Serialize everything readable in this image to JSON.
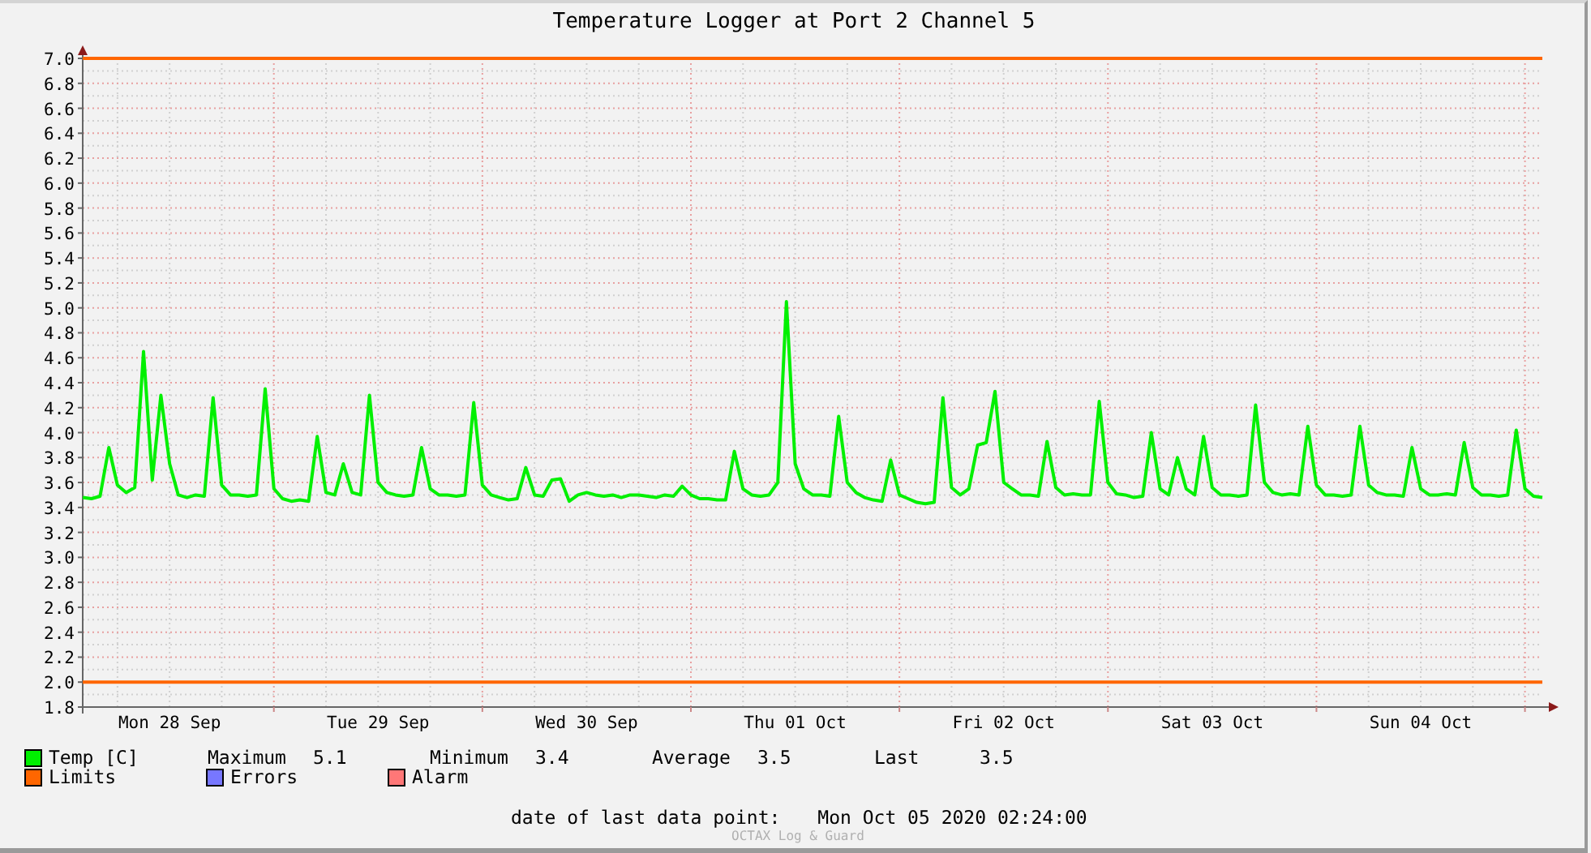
{
  "graph": {
    "chart_data": {
      "type": "line",
      "title": "Temperature Logger at Port 2 Channel 5",
      "series": [
        {
          "name": "Temp [C]",
          "color": "#00f000",
          "values": [
            3.48,
            3.47,
            3.49,
            3.88,
            3.58,
            3.52,
            3.56,
            4.65,
            3.62,
            4.3,
            3.75,
            3.5,
            3.48,
            3.5,
            3.49,
            4.28,
            3.58,
            3.5,
            3.5,
            3.49,
            3.5,
            4.35,
            3.55,
            3.47,
            3.45,
            3.46,
            3.45,
            3.97,
            3.52,
            3.5,
            3.75,
            3.52,
            3.5,
            4.3,
            3.6,
            3.52,
            3.5,
            3.49,
            3.5,
            3.88,
            3.55,
            3.5,
            3.5,
            3.49,
            3.5,
            4.24,
            3.58,
            3.5,
            3.48,
            3.46,
            3.47,
            3.72,
            3.5,
            3.49,
            3.62,
            3.63,
            3.45,
            3.5,
            3.52,
            3.5,
            3.49,
            3.5,
            3.48,
            3.5,
            3.5,
            3.49,
            3.48,
            3.5,
            3.49,
            3.57,
            3.5,
            3.47,
            3.47,
            3.46,
            3.46,
            3.85,
            3.55,
            3.5,
            3.49,
            3.5,
            3.6,
            5.05,
            3.75,
            3.55,
            3.5,
            3.5,
            3.49,
            4.13,
            3.6,
            3.52,
            3.48,
            3.46,
            3.45,
            3.78,
            3.5,
            3.47,
            3.44,
            3.43,
            3.44,
            4.28,
            3.56,
            3.5,
            3.55,
            3.9,
            3.92,
            4.33,
            3.6,
            3.55,
            3.5,
            3.5,
            3.49,
            3.93,
            3.56,
            3.5,
            3.51,
            3.5,
            3.5,
            4.25,
            3.6,
            3.51,
            3.5,
            3.48,
            3.49,
            4.0,
            3.55,
            3.5,
            3.8,
            3.55,
            3.5,
            3.97,
            3.56,
            3.5,
            3.5,
            3.49,
            3.5,
            4.22,
            3.6,
            3.52,
            3.5,
            3.51,
            3.5,
            4.05,
            3.58,
            3.5,
            3.5,
            3.49,
            3.5,
            4.05,
            3.58,
            3.52,
            3.5,
            3.5,
            3.49,
            3.88,
            3.55,
            3.5,
            3.5,
            3.51,
            3.5,
            3.92,
            3.56,
            3.5,
            3.5,
            3.49,
            3.5,
            4.02,
            3.55,
            3.49,
            3.48
          ]
        }
      ],
      "ylim": [
        1.8,
        7.0
      ],
      "categories": [
        null,
        null,
        null,
        null,
        null,
        null,
        null,
        null,
        null,
        null,
        "Mon 28 Sep",
        null,
        null,
        null,
        null,
        null,
        null,
        null,
        null,
        null,
        null,
        null,
        null,
        null,
        null,
        null,
        null,
        null,
        null,
        null,
        null,
        null,
        null,
        null,
        "Tue 29 Sep",
        null,
        null,
        null,
        null,
        null,
        null,
        null,
        null,
        null,
        null,
        null,
        null,
        null,
        null,
        null,
        null,
        null,
        null,
        null,
        null,
        null,
        null,
        null,
        "Wed 30 Sep",
        null,
        null,
        null,
        null,
        null,
        null,
        null,
        null,
        null,
        null,
        null,
        null,
        null,
        null,
        null,
        null,
        null,
        null,
        null,
        null,
        null,
        null,
        null,
        "Thu 01 Oct",
        null,
        null,
        null,
        null,
        null,
        null,
        null,
        null,
        null,
        null,
        null,
        null,
        null,
        null,
        null,
        null,
        null,
        null,
        null,
        null,
        null,
        null,
        null,
        "Fri 02 Oct",
        null,
        null,
        null,
        null,
        null,
        null,
        null,
        null,
        null,
        null,
        null,
        null,
        null,
        null,
        null,
        null,
        null,
        null,
        null,
        null,
        null,
        null,
        null,
        "Sat 03 Oct",
        null,
        null,
        null,
        null,
        null,
        null,
        null,
        null,
        null,
        null,
        null,
        null,
        null,
        null,
        null,
        null,
        null,
        null,
        null,
        null,
        null,
        null,
        null,
        "Sun 04 Oct",
        null,
        null,
        null,
        null,
        null,
        null,
        null,
        null,
        null,
        null,
        null,
        null,
        null,
        null
      ],
      "yticks": [
        {
          "value": 1.8,
          "label": "1.8"
        },
        {
          "value": 2.0,
          "label": "2.0"
        },
        {
          "value": 2.2,
          "label": "2.2"
        },
        {
          "value": 2.4,
          "label": "2.4"
        },
        {
          "value": 2.6,
          "label": "2.6"
        },
        {
          "value": 2.8,
          "label": "2.8"
        },
        {
          "value": 3.0,
          "label": "3.0"
        },
        {
          "value": 3.2,
          "label": "3.2"
        },
        {
          "value": 3.4,
          "label": "3.4"
        },
        {
          "value": 3.6,
          "label": "3.6"
        },
        {
          "value": 3.8,
          "label": "3.8"
        },
        {
          "value": 4.0,
          "label": "4.0"
        },
        {
          "value": 4.2,
          "label": "4.2"
        },
        {
          "value": 4.4,
          "label": "4.4"
        },
        {
          "value": 4.6,
          "label": "4.6"
        },
        {
          "value": 4.8,
          "label": "4.8"
        },
        {
          "value": 5.0,
          "label": "5.0"
        },
        {
          "value": 5.2,
          "label": "5.2"
        },
        {
          "value": 5.4,
          "label": "5.4"
        },
        {
          "value": 5.6,
          "label": "5.6"
        },
        {
          "value": 5.8,
          "label": "5.8"
        },
        {
          "value": 6.0,
          "label": "6.0"
        },
        {
          "value": 6.2,
          "label": "6.2"
        },
        {
          "value": 6.4,
          "label": "6.4"
        },
        {
          "value": 6.6,
          "label": "6.6"
        },
        {
          "value": 6.8,
          "label": "6.8"
        },
        {
          "value": 7.0,
          "label": "7.0"
        }
      ],
      "grid": true,
      "ref_lines": [
        {
          "axis": "y",
          "value": 7.0
        },
        {
          "axis": "y",
          "value": 2.0
        }
      ]
    }
  },
  "legend": [
    {
      "name": "Limits",
      "color": "#ff6600"
    },
    {
      "name": "Errors",
      "color": "#7777ff"
    },
    {
      "name": "Alarm",
      "color": "#ff7777"
    }
  ],
  "stats": [
    {
      "label": "Maximum",
      "value": "5.1"
    },
    {
      "label": "Minimum",
      "value": "3.4"
    },
    {
      "label": "Average",
      "value": "3.5"
    },
    {
      "label": "Last",
      "value": "3.5"
    }
  ],
  "footer": {
    "label": "date of last data point:",
    "value": "Mon Oct 05 2020 02:24:00",
    "credit": "OCTAX Log & Guard"
  }
}
